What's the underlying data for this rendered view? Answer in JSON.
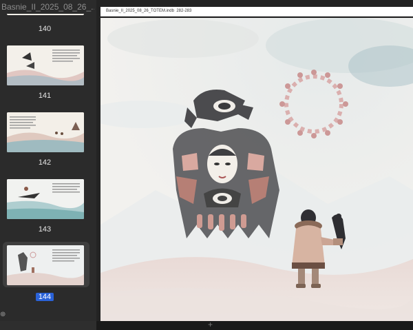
{
  "sidebar": {
    "title": "Basnie_II_2025_08_26_...",
    "pages": [
      {
        "number": "140",
        "selected": false
      },
      {
        "number": "141",
        "selected": false
      },
      {
        "number": "142",
        "selected": false
      },
      {
        "number": "143",
        "selected": false
      },
      {
        "number": "144",
        "selected": true
      }
    ]
  },
  "document": {
    "file_name": "Basnie_II_2025_08_26_TOTEM.indb",
    "page_range": "282-283"
  },
  "icons": {
    "add": "plus-icon",
    "sidebar_add": "circle-plus-icon"
  },
  "colors": {
    "selection": "#2a62d8",
    "sidebar_bg": "#2b2b2b"
  }
}
